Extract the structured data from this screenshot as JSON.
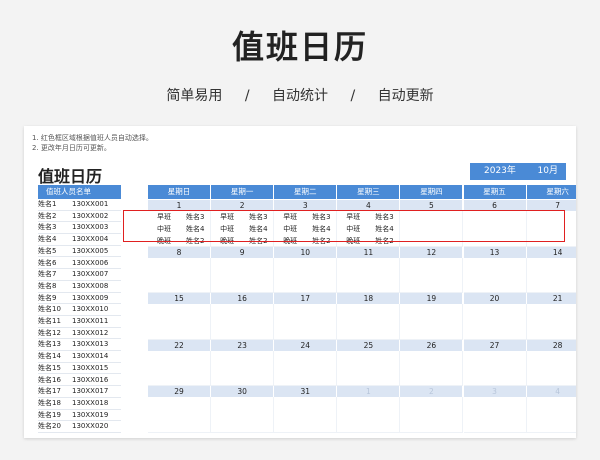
{
  "hero": {
    "title": "值班日历",
    "subtitle": "简单易用 / 自动统计 / 自动更新"
  },
  "notes": [
    "1. 红色框区域根据值班人员自动选择。",
    "2. 更改年月日历可更新。"
  ],
  "calendar": {
    "title": "值班日历",
    "year": "2023年",
    "month": "10月"
  },
  "roster": {
    "header": "值班人员名单",
    "rows": [
      {
        "name": "姓名1",
        "phone": "130XX001"
      },
      {
        "name": "姓名2",
        "phone": "130XX002"
      },
      {
        "name": "姓名3",
        "phone": "130XX003"
      },
      {
        "name": "姓名4",
        "phone": "130XX004"
      },
      {
        "name": "姓名5",
        "phone": "130XX005"
      },
      {
        "name": "姓名6",
        "phone": "130XX006"
      },
      {
        "name": "姓名7",
        "phone": "130XX007"
      },
      {
        "name": "姓名8",
        "phone": "130XX008"
      },
      {
        "name": "姓名9",
        "phone": "130XX009"
      },
      {
        "name": "姓名10",
        "phone": "130XX010"
      },
      {
        "name": "姓名11",
        "phone": "130XX011"
      },
      {
        "name": "姓名12",
        "phone": "130XX012"
      },
      {
        "name": "姓名13",
        "phone": "130XX013"
      },
      {
        "name": "姓名14",
        "phone": "130XX014"
      },
      {
        "name": "姓名15",
        "phone": "130XX015"
      },
      {
        "name": "姓名16",
        "phone": "130XX016"
      },
      {
        "name": "姓名17",
        "phone": "130XX017"
      },
      {
        "name": "姓名18",
        "phone": "130XX018"
      },
      {
        "name": "姓名19",
        "phone": "130XX019"
      },
      {
        "name": "姓名20",
        "phone": "130XX020"
      }
    ]
  },
  "weekdays": [
    "星期日",
    "星期一",
    "星期二",
    "星期三",
    "星期四",
    "星期五",
    "星期六"
  ],
  "weeks": [
    {
      "days": [
        {
          "n": "1"
        },
        {
          "n": "2"
        },
        {
          "n": "3"
        },
        {
          "n": "4"
        },
        {
          "n": "5"
        },
        {
          "n": "6"
        },
        {
          "n": "7"
        }
      ]
    },
    {
      "days": [
        {
          "n": "8"
        },
        {
          "n": "9"
        },
        {
          "n": "10"
        },
        {
          "n": "11"
        },
        {
          "n": "12"
        },
        {
          "n": "13"
        },
        {
          "n": "14"
        }
      ]
    },
    {
      "days": [
        {
          "n": "15"
        },
        {
          "n": "16"
        },
        {
          "n": "17"
        },
        {
          "n": "18"
        },
        {
          "n": "19"
        },
        {
          "n": "20"
        },
        {
          "n": "21"
        }
      ]
    },
    {
      "days": [
        {
          "n": "22"
        },
        {
          "n": "23"
        },
        {
          "n": "24"
        },
        {
          "n": "25"
        },
        {
          "n": "26"
        },
        {
          "n": "27"
        },
        {
          "n": "28"
        }
      ]
    },
    {
      "days": [
        {
          "n": "29"
        },
        {
          "n": "30"
        },
        {
          "n": "31"
        },
        {
          "n": "1",
          "faded": true
        },
        {
          "n": "2",
          "faded": true
        },
        {
          "n": "3",
          "faded": true
        },
        {
          "n": "4",
          "faded": true
        }
      ]
    }
  ],
  "shifts": [
    [
      [
        "早班",
        "姓名3"
      ],
      [
        "中班",
        "姓名4"
      ],
      [
        "晚班",
        "姓名2"
      ]
    ],
    [
      [
        "早班",
        "姓名3"
      ],
      [
        "中班",
        "姓名4"
      ],
      [
        "晚班",
        "姓名2"
      ]
    ],
    [
      [
        "早班",
        "姓名3"
      ],
      [
        "中班",
        "姓名4"
      ],
      [
        "晚班",
        "姓名2"
      ]
    ],
    [
      [
        "早班",
        "姓名3"
      ],
      [
        "中班",
        "姓名4"
      ],
      [
        "晚班",
        "姓名2"
      ]
    ]
  ],
  "colors": {
    "accent": "#4a8ad6",
    "day_row": "#dbe5f3",
    "highlight": "#e02020"
  }
}
